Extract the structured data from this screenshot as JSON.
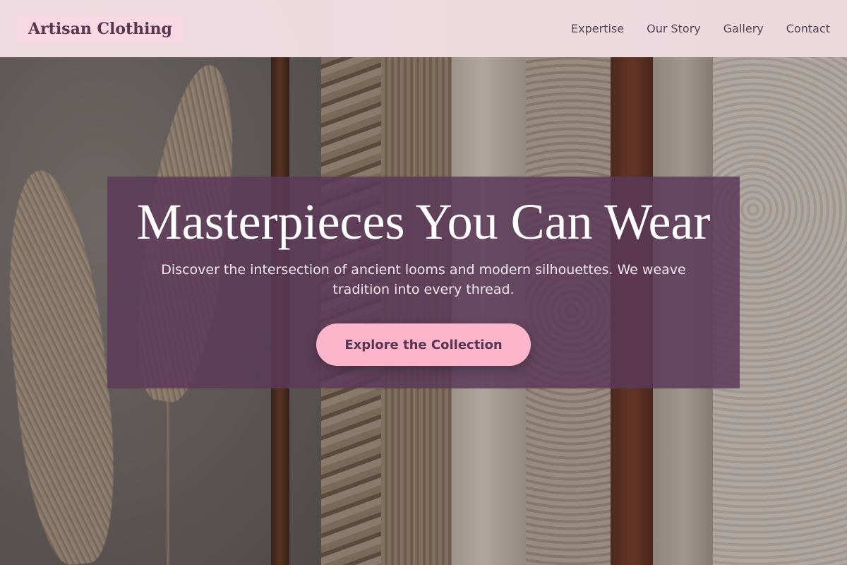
{
  "header": {
    "logo": "Artisan Clothing",
    "nav": [
      {
        "label": "Expertise"
      },
      {
        "label": "Our Story"
      },
      {
        "label": "Gallery"
      },
      {
        "label": "Contact"
      }
    ]
  },
  "hero": {
    "title": "Masterpieces You Can Wear",
    "subtitle": "Discover the intersection of ancient looms and modern silhouettes. We weave tradition into every thread.",
    "cta_label": "Explore the Collection"
  },
  "colors": {
    "header_bg": "#fae4eb",
    "brand": "#5a3550",
    "overlay": "#5c3a58",
    "cta": "#fbb6cc"
  }
}
